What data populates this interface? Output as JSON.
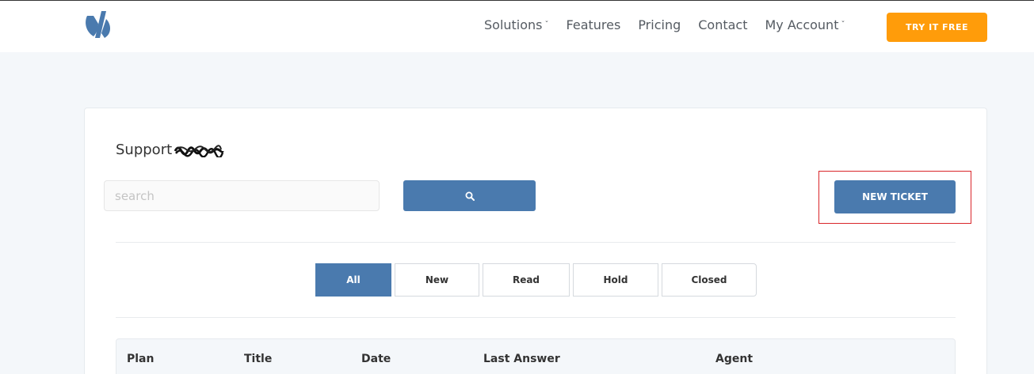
{
  "nav": {
    "items": [
      {
        "label": "Solutions",
        "has_caret": true
      },
      {
        "label": "Features",
        "has_caret": false
      },
      {
        "label": "Pricing",
        "has_caret": false
      },
      {
        "label": "Contact",
        "has_caret": false
      },
      {
        "label": "My Account",
        "has_caret": true
      }
    ],
    "cta_label": "TRY IT FREE"
  },
  "page": {
    "title": "Support",
    "search_placeholder": "search",
    "search_value": "",
    "new_ticket_label": "NEW TICKET"
  },
  "filters": {
    "tabs": [
      "All",
      "New",
      "Read",
      "Hold",
      "Closed"
    ],
    "active": "All"
  },
  "table": {
    "columns": [
      "Plan",
      "Title",
      "Date",
      "Last Answer",
      "Agent"
    ]
  },
  "colors": {
    "accent": "#4a7aae",
    "cta": "#ff9c0a",
    "highlight": "#d9262a"
  },
  "icons": {
    "logo": "brand-logo-icon",
    "search_button": "search-icon",
    "caret": "chevron-down-icon"
  }
}
